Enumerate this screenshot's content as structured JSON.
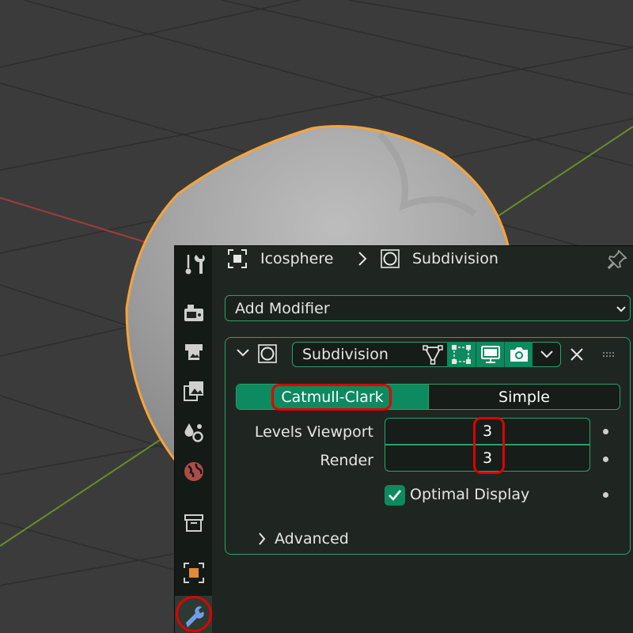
{
  "breadcrumb": {
    "object": "Icosphere",
    "modifier": "Subdivision"
  },
  "add_modifier": {
    "label": "Add Modifier"
  },
  "modifier": {
    "name": "Subdivision",
    "algorithm": {
      "options": [
        "Catmull-Clark",
        "Simple"
      ],
      "selected": "Catmull-Clark"
    },
    "levels_viewport": {
      "label": "Levels Viewport",
      "value": "3"
    },
    "render": {
      "label": "Render",
      "value": "3"
    },
    "optimal_display": {
      "label": "Optimal Display",
      "checked": true
    },
    "advanced": {
      "label": "Advanced",
      "expanded": false
    }
  },
  "tabs": [
    "tool",
    "render",
    "output",
    "view-layer",
    "scene",
    "world",
    "collection",
    "object",
    "modifiers"
  ],
  "active_tab": "modifiers",
  "colors": {
    "accent": "#2aa06c",
    "active_button": "#0d8a5f",
    "highlight": "#e00000",
    "selection_outline": "#f7a33a"
  }
}
